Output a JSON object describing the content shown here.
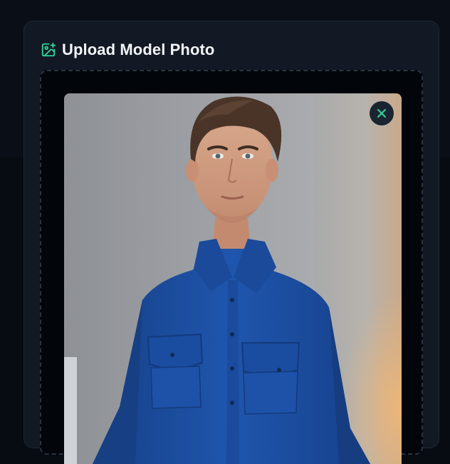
{
  "upload_card": {
    "title": "Upload Model Photo",
    "title_icon": "image-plus-icon",
    "remove_icon": "close-icon"
  },
  "colors": {
    "accent": "#2fd49a",
    "card_background": "#121924",
    "page_background": "#070b12",
    "shirt": "#1c4fa0"
  }
}
